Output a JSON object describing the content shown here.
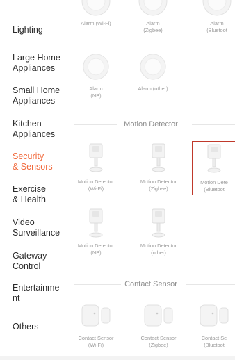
{
  "sidebar": {
    "items": [
      {
        "label": "Lighting",
        "active": false
      },
      {
        "label": "Large Home\nAppliances",
        "active": false
      },
      {
        "label": "Small Home\nAppliances",
        "active": false
      },
      {
        "label": "Kitchen\nAppliances",
        "active": false
      },
      {
        "label": "Security\n& Sensors",
        "active": true
      },
      {
        "label": "Exercise\n& Health",
        "active": false
      },
      {
        "label": "Video\nSurveillance",
        "active": false
      },
      {
        "label": "Gateway\nControl",
        "active": false
      },
      {
        "label": "Entertainme\nnt",
        "active": false
      },
      {
        "label": "Others",
        "active": false
      }
    ]
  },
  "colors": {
    "accent": "#f1683a",
    "selected_border": "#c0392b"
  },
  "alarms": {
    "items": [
      {
        "label": "Alarm (Wi-Fi)",
        "icon": "alarm-icon"
      },
      {
        "label": "Alarm\n(Zigbee)",
        "icon": "alarm-icon"
      },
      {
        "label": "Alarm\n(Bluetoot",
        "icon": "alarm-icon"
      },
      {
        "label": "Alarm\n(NB)",
        "icon": "alarm-icon"
      },
      {
        "label": "Alarm (other)",
        "icon": "alarm-icon"
      }
    ]
  },
  "motion": {
    "title": "Motion Detector",
    "items": [
      {
        "label": "Motion Detector\n(Wi-Fi)",
        "icon": "motion-detector-icon"
      },
      {
        "label": "Motion Detector\n(Zigbee)",
        "icon": "motion-detector-icon"
      },
      {
        "label": "Motion Dete\n(Bluetoot",
        "icon": "motion-detector-icon",
        "selected": true
      },
      {
        "label": "Motion Detector\n(NB)",
        "icon": "motion-detector-icon"
      },
      {
        "label": "Motion Detector\n(other)",
        "icon": "motion-detector-icon"
      }
    ]
  },
  "contact": {
    "title": "Contact Sensor",
    "items": [
      {
        "label": "Contact Sensor\n(Wi-Fi)",
        "icon": "contact-sensor-icon"
      },
      {
        "label": "Contact Sensor\n(Zigbee)",
        "icon": "contact-sensor-icon"
      },
      {
        "label": "Contact Se\n(Bluetoot",
        "icon": "contact-sensor-icon"
      }
    ]
  }
}
